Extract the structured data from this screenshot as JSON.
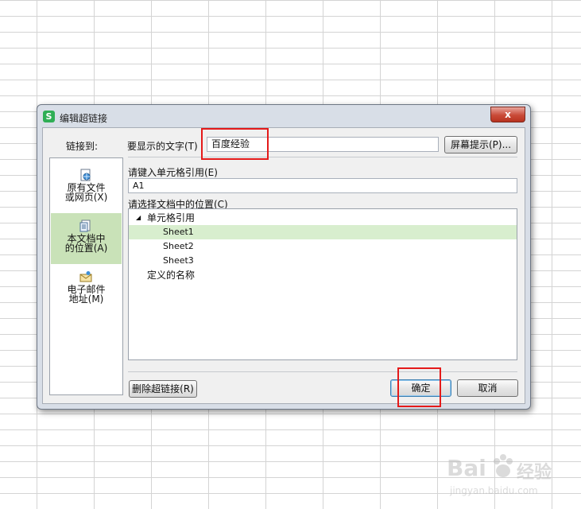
{
  "dialog": {
    "title": "编辑超链接",
    "app_icon_letter": "S",
    "close_glyph": "x"
  },
  "link_to": {
    "label": "链接到:",
    "items": [
      {
        "line1": "原有文件",
        "line2": "或网页(X)",
        "icon": "web-page-icon",
        "selected": false
      },
      {
        "line1": "本文档中",
        "line2": "的位置(A)",
        "icon": "document-location-icon",
        "selected": true
      },
      {
        "line1": "电子邮件",
        "line2": "地址(M)",
        "icon": "email-address-icon",
        "selected": false
      }
    ]
  },
  "display_text": {
    "label": "要显示的文字(T)",
    "value": "百度经验"
  },
  "screen_tip_button": "屏幕提示(P)...",
  "cell_ref": {
    "label": "请键入单元格引用(E)",
    "value": "A1"
  },
  "location": {
    "label": "请选择文档中的位置(C)",
    "tree": [
      {
        "text": "单元格引用",
        "level": 0,
        "expanded": true
      },
      {
        "text": "Sheet1",
        "level": 1,
        "selected": true
      },
      {
        "text": "Sheet2",
        "level": 1
      },
      {
        "text": "Sheet3",
        "level": 1
      },
      {
        "text": "定义的名称",
        "level": 0
      }
    ],
    "expand_glyph": "◢"
  },
  "buttons": {
    "remove_link": "删除超链接(R)",
    "ok": "确定",
    "cancel": "取消"
  },
  "watermark": {
    "brand": "Bai",
    "brand_suffix": "经验",
    "url": "jingyan.baidu.com"
  },
  "colors": {
    "selected_nav": "#c9e2b8",
    "selected_tree": "#d8eece",
    "highlight_box": "#e41a1a",
    "close_button": "#c94b38"
  }
}
